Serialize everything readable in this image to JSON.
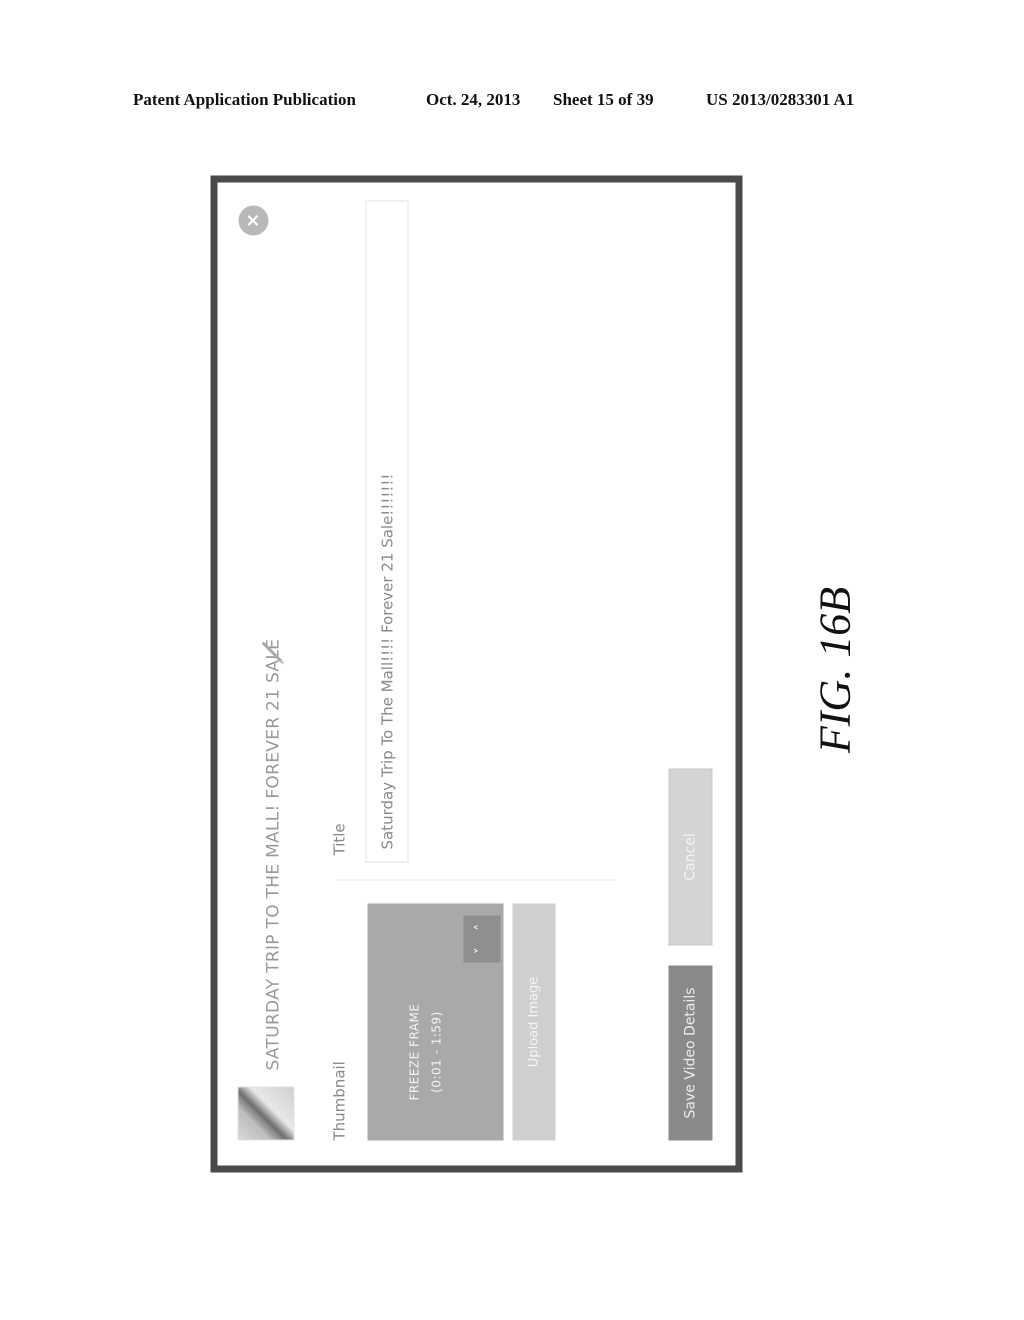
{
  "publication_header": {
    "label": "Patent Application Publication",
    "date": "Oct. 24, 2013",
    "sheet": "Sheet 15 of 39",
    "number": "US 2013/0283301 A1"
  },
  "dialog": {
    "header_title": "SATURDAY TRIP TO THE MALL! FOREVER 21 SALE",
    "icons": {
      "edit": "pencil-icon",
      "close": "close-icon",
      "avatar": "video-thumbnail"
    },
    "thumbnail": {
      "label": "Thumbnail",
      "freeze_frame_line1": "FREEZE FRAME",
      "freeze_frame_line2": "(0:01 - 1:59)",
      "arrow_up": "˄",
      "arrow_down": "˅",
      "upload_label": "Upload Image"
    },
    "title_field": {
      "label": "Title",
      "value": "Saturday Trip To The Mall!!!! Forever 21 Sale!!!!!!!"
    },
    "buttons": {
      "save": "Save Video Details",
      "cancel": "Cancel"
    },
    "colors": {
      "border": "#4a4a4a",
      "primary_button": "#8a8a8a",
      "secondary_button": "#d4d4d4",
      "freeze_frame": "#a9a9a9"
    }
  },
  "figure_label": "FIG. 16B"
}
